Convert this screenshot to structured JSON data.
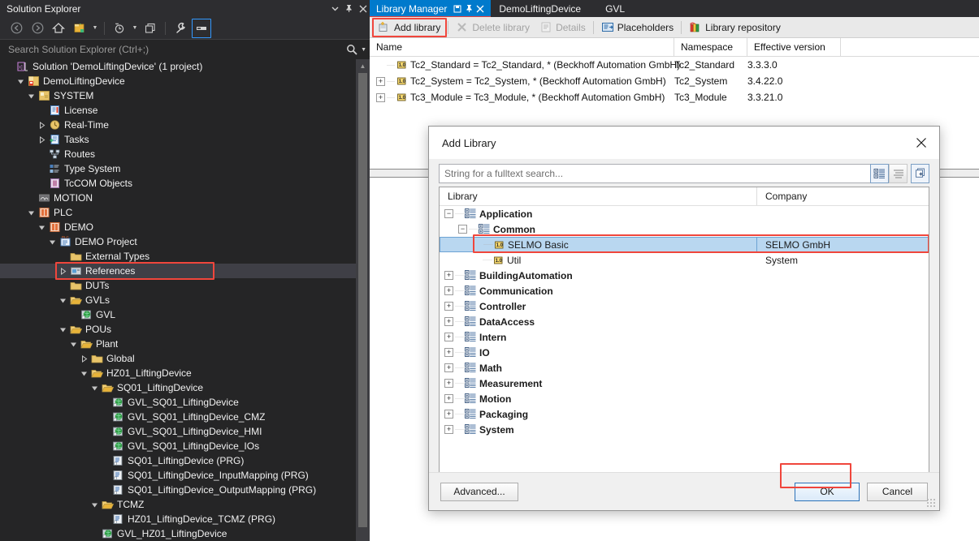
{
  "solution_explorer": {
    "title": "Solution Explorer",
    "title_buttons": [
      "dropdown",
      "pin",
      "close"
    ],
    "toolbar": [
      {
        "name": "back",
        "icon": "arrow-left-circle-icon"
      },
      {
        "name": "forward",
        "icon": "arrow-right-circle-icon"
      },
      {
        "name": "home",
        "icon": "home-icon"
      },
      {
        "name": "sync-with-active-document",
        "icon": "sync-folder-icon"
      },
      {
        "name": "sync-dropdown",
        "icon": "chevron-down-icon"
      },
      {
        "name": "show-all-files",
        "icon": "clock-icon"
      },
      {
        "name": "pending-changes-dropdown",
        "icon": "chevron-down-icon"
      },
      {
        "name": "refresh",
        "icon": "copy-windows-icon"
      },
      {
        "name": "properties",
        "icon": "wrench-icon"
      },
      {
        "name": "preview-selected-items",
        "icon": "preview-icon"
      }
    ],
    "search": {
      "placeholder": "Search Solution Explorer (Ctrl+;)",
      "value": ""
    },
    "tree": [
      {
        "label": "Solution 'DemoLiftingDevice' (1 project)",
        "depth": 0,
        "expander": "none",
        "icon": "vs-solution-icon",
        "selected": false
      },
      {
        "label": "DemoLiftingDevice",
        "depth": 1,
        "expander": "open",
        "icon": "tc-project-icon",
        "selected": false
      },
      {
        "label": "SYSTEM",
        "depth": 2,
        "expander": "open",
        "icon": "system-icon",
        "selected": false
      },
      {
        "label": "License",
        "depth": 3,
        "expander": "none",
        "icon": "license-icon",
        "selected": false
      },
      {
        "label": "Real-Time",
        "depth": 3,
        "expander": "closed",
        "icon": "realtime-icon",
        "selected": false
      },
      {
        "label": "Tasks",
        "depth": 3,
        "expander": "closed",
        "icon": "tasks-icon",
        "selected": false
      },
      {
        "label": "Routes",
        "depth": 3,
        "expander": "none",
        "icon": "routes-icon",
        "selected": false
      },
      {
        "label": "Type System",
        "depth": 3,
        "expander": "none",
        "icon": "typesystem-icon",
        "selected": false
      },
      {
        "label": "TcCOM Objects",
        "depth": 3,
        "expander": "none",
        "icon": "tccom-icon",
        "selected": false
      },
      {
        "label": "MOTION",
        "depth": 2,
        "expander": "none",
        "icon": "motion-icon",
        "selected": false
      },
      {
        "label": "PLC",
        "depth": 2,
        "expander": "open",
        "icon": "plc-icon",
        "selected": false
      },
      {
        "label": "DEMO",
        "depth": 3,
        "expander": "open",
        "icon": "plc-project-icon",
        "selected": false
      },
      {
        "label": "DEMO Project",
        "depth": 4,
        "expander": "open",
        "icon": "plc-prj-icon",
        "selected": false
      },
      {
        "label": "External Types",
        "depth": 5,
        "expander": "none",
        "icon": "folder-closed-icon",
        "selected": false
      },
      {
        "label": "References",
        "depth": 5,
        "expander": "closed",
        "icon": "references-icon",
        "selected": true,
        "highlight": true
      },
      {
        "label": "DUTs",
        "depth": 5,
        "expander": "none",
        "icon": "folder-closed-icon",
        "selected": false
      },
      {
        "label": "GVLs",
        "depth": 5,
        "expander": "open",
        "icon": "folder-open-icon",
        "selected": false
      },
      {
        "label": "GVL",
        "depth": 6,
        "expander": "none",
        "icon": "gvl-icon",
        "selected": false
      },
      {
        "label": "POUs",
        "depth": 5,
        "expander": "open",
        "icon": "folder-open-icon",
        "selected": false
      },
      {
        "label": "Plant",
        "depth": 6,
        "expander": "open",
        "icon": "folder-open-icon",
        "selected": false
      },
      {
        "label": "Global",
        "depth": 7,
        "expander": "closed",
        "icon": "folder-closed-icon",
        "selected": false
      },
      {
        "label": "HZ01_LiftingDevice",
        "depth": 7,
        "expander": "open",
        "icon": "folder-open-icon",
        "selected": false
      },
      {
        "label": "SQ01_LiftingDevice",
        "depth": 8,
        "expander": "open",
        "icon": "folder-open-icon",
        "selected": false
      },
      {
        "label": "GVL_SQ01_LiftingDevice",
        "depth": 9,
        "expander": "none",
        "icon": "gvl-icon",
        "selected": false
      },
      {
        "label": "GVL_SQ01_LiftingDevice_CMZ",
        "depth": 9,
        "expander": "none",
        "icon": "gvl-icon",
        "selected": false
      },
      {
        "label": "GVL_SQ01_LiftingDevice_HMI",
        "depth": 9,
        "expander": "none",
        "icon": "gvl-icon",
        "selected": false
      },
      {
        "label": "GVL_SQ01_LiftingDevice_IOs",
        "depth": 9,
        "expander": "none",
        "icon": "gvl-icon",
        "selected": false
      },
      {
        "label": "SQ01_LiftingDevice (PRG)",
        "depth": 9,
        "expander": "none",
        "icon": "prg-icon",
        "selected": false
      },
      {
        "label": "SQ01_LiftingDevice_InputMapping (PRG)",
        "depth": 9,
        "expander": "none",
        "icon": "prg-icon",
        "selected": false
      },
      {
        "label": "SQ01_LiftingDevice_OutputMapping (PRG)",
        "depth": 9,
        "expander": "none",
        "icon": "prg-icon",
        "selected": false
      },
      {
        "label": "TCMZ",
        "depth": 8,
        "expander": "open",
        "icon": "folder-open-icon",
        "selected": false
      },
      {
        "label": "HZ01_LiftingDevice_TCMZ (PRG)",
        "depth": 9,
        "expander": "none",
        "icon": "prg-icon",
        "selected": false
      },
      {
        "label": "GVL_HZ01_LiftingDevice",
        "depth": 8,
        "expander": "none",
        "icon": "gvl-icon",
        "selected": false
      }
    ]
  },
  "main": {
    "tabs": [
      {
        "label": "Library Manager",
        "active": true,
        "buttons": [
          "save-icon",
          "pin-icon",
          "close-icon"
        ]
      },
      {
        "label": "DemoLiftingDevice",
        "active": false,
        "buttons": []
      },
      {
        "label": "GVL",
        "active": false,
        "buttons": []
      }
    ],
    "toolbar": [
      {
        "label": "Add library",
        "icon": "add-library-icon",
        "enabled": true,
        "highlight": true
      },
      {
        "label": "Delete library",
        "icon": "delete-library-icon",
        "enabled": false
      },
      {
        "label": "Details",
        "icon": "details-icon",
        "enabled": false
      },
      {
        "label": "Placeholders",
        "icon": "placeholders-icon",
        "enabled": true
      },
      {
        "label": "Library repository",
        "icon": "library-repository-icon",
        "enabled": true
      }
    ],
    "columns": [
      "Name",
      "Namespace",
      "Effective version"
    ],
    "rows": [
      {
        "expander": "none",
        "name": "Tc2_Standard = Tc2_Standard, * (Beckhoff Automation GmbH)",
        "namespace": "Tc2_Standard",
        "version": "3.3.3.0"
      },
      {
        "expander": "plus",
        "name": "Tc2_System = Tc2_System, * (Beckhoff Automation GmbH)",
        "namespace": "Tc2_System",
        "version": "3.4.22.0"
      },
      {
        "expander": "plus",
        "name": "Tc3_Module = Tc3_Module, * (Beckhoff Automation GmbH)",
        "namespace": "Tc3_Module",
        "version": "3.3.21.0"
      }
    ]
  },
  "dialog": {
    "title": "Add Library",
    "close_label": "✕",
    "search": {
      "placeholder": "String for a fulltext search...",
      "value": ""
    },
    "view_buttons": [
      {
        "name": "flat-view-button",
        "icon": "grouped-list-icon",
        "active": true
      },
      {
        "name": "text-view-button",
        "icon": "flat-list-icon",
        "active": false
      },
      {
        "name": "add-placeholder-button",
        "icon": "add-copy-icon",
        "active": true
      }
    ],
    "columns": [
      "Library",
      "Company"
    ],
    "tree": [
      {
        "library": "Application",
        "company": "",
        "depth": 0,
        "expander": "minus",
        "icon": "category-icon",
        "bold": true,
        "selected": false
      },
      {
        "library": "Common",
        "company": "",
        "depth": 1,
        "expander": "minus",
        "icon": "category-icon",
        "bold": true,
        "selected": false
      },
      {
        "library": "SELMO Basic",
        "company": "SELMO GmbH",
        "depth": 2,
        "expander": "none",
        "icon": "library-icon",
        "bold": false,
        "selected": true,
        "highlight": true
      },
      {
        "library": "Util",
        "company": "System",
        "depth": 2,
        "expander": "none",
        "icon": "library-icon",
        "bold": false,
        "selected": false
      },
      {
        "library": "BuildingAutomation",
        "company": "",
        "depth": 0,
        "expander": "plus",
        "icon": "category-icon",
        "bold": true,
        "selected": false
      },
      {
        "library": "Communication",
        "company": "",
        "depth": 0,
        "expander": "plus",
        "icon": "category-icon",
        "bold": true,
        "selected": false
      },
      {
        "library": "Controller",
        "company": "",
        "depth": 0,
        "expander": "plus",
        "icon": "category-icon",
        "bold": true,
        "selected": false
      },
      {
        "library": "DataAccess",
        "company": "",
        "depth": 0,
        "expander": "plus",
        "icon": "category-icon",
        "bold": true,
        "selected": false
      },
      {
        "library": "Intern",
        "company": "",
        "depth": 0,
        "expander": "plus",
        "icon": "category-icon",
        "bold": true,
        "selected": false
      },
      {
        "library": "IO",
        "company": "",
        "depth": 0,
        "expander": "plus",
        "icon": "category-icon",
        "bold": true,
        "selected": false
      },
      {
        "library": "Math",
        "company": "",
        "depth": 0,
        "expander": "plus",
        "icon": "category-icon",
        "bold": true,
        "selected": false
      },
      {
        "library": "Measurement",
        "company": "",
        "depth": 0,
        "expander": "plus",
        "icon": "category-icon",
        "bold": true,
        "selected": false
      },
      {
        "library": "Motion",
        "company": "",
        "depth": 0,
        "expander": "plus",
        "icon": "category-icon",
        "bold": true,
        "selected": false
      },
      {
        "library": "Packaging",
        "company": "",
        "depth": 0,
        "expander": "plus",
        "icon": "category-icon",
        "bold": true,
        "selected": false
      },
      {
        "library": "System",
        "company": "",
        "depth": 0,
        "expander": "plus",
        "icon": "category-icon",
        "bold": true,
        "selected": false
      }
    ],
    "buttons": {
      "advanced": "Advanced...",
      "ok": "OK",
      "cancel": "Cancel"
    }
  },
  "colors": {
    "accent_blue": "#007acc",
    "highlight_red": "#f0463c",
    "selection_blue": "#b9d7f0",
    "dark_chrome": "#2d2d30",
    "tree_background": "#252526",
    "tab_underline_red": "#e8413a"
  }
}
